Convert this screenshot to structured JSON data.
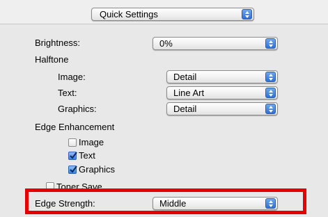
{
  "quick_settings": {
    "label": "Quick Settings"
  },
  "brightness": {
    "label": "Brightness:",
    "value": "0%"
  },
  "halftone": {
    "heading": "Halftone",
    "image": {
      "label": "Image:",
      "value": "Detail"
    },
    "text": {
      "label": "Text:",
      "value": "Line Art"
    },
    "graphics": {
      "label": "Graphics:",
      "value": "Detail"
    }
  },
  "edge_enhancement": {
    "heading": "Edge Enhancement",
    "image": {
      "label": "Image",
      "checked": false
    },
    "text": {
      "label": "Text",
      "checked": true
    },
    "graphics": {
      "label": "Graphics",
      "checked": true
    }
  },
  "toner_save": {
    "label": "Toner Save",
    "checked": false
  },
  "edge_strength": {
    "label": "Edge Strength:",
    "value": "Middle"
  },
  "colors": {
    "highlight_border": "#e60000",
    "popup_arrow": "#2f6fd6",
    "panel_bg": "#e8e8e8"
  },
  "icons": {
    "popup_arrows": "up-down-arrows-icon",
    "checkmark": "checkmark-icon"
  }
}
